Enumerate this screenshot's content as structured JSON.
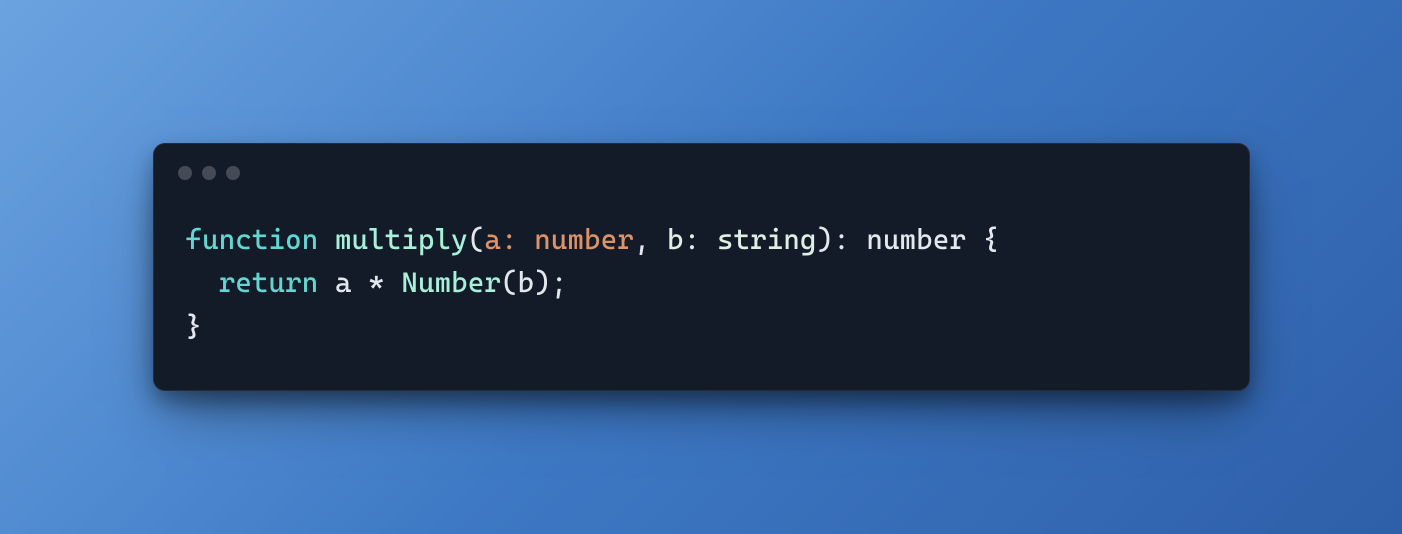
{
  "window": {
    "traffic_lights": [
      "close",
      "minimize",
      "zoom"
    ]
  },
  "code": {
    "language": "typescript",
    "tokens": [
      [
        {
          "t": "function",
          "cls": "tok-keyword"
        },
        {
          "t": " ",
          "cls": "tok-default"
        },
        {
          "t": "multiply",
          "cls": "tok-func"
        },
        {
          "t": "(",
          "cls": "tok-punct"
        },
        {
          "t": "a",
          "cls": "tok-param1"
        },
        {
          "t": ": ",
          "cls": "tok-type1"
        },
        {
          "t": "number",
          "cls": "tok-type1"
        },
        {
          "t": ", ",
          "cls": "tok-punct"
        },
        {
          "t": "b",
          "cls": "tok-param2"
        },
        {
          "t": ": ",
          "cls": "tok-type2"
        },
        {
          "t": "string",
          "cls": "tok-type2"
        },
        {
          "t": ")",
          "cls": "tok-punct"
        },
        {
          "t": ": ",
          "cls": "tok-rettype"
        },
        {
          "t": "number",
          "cls": "tok-rettype"
        },
        {
          "t": " {",
          "cls": "tok-punct"
        }
      ],
      [
        {
          "t": "  ",
          "cls": "tok-default"
        },
        {
          "t": "return",
          "cls": "tok-return"
        },
        {
          "t": " ",
          "cls": "tok-default"
        },
        {
          "t": "a",
          "cls": "tok-var"
        },
        {
          "t": " * ",
          "cls": "tok-op"
        },
        {
          "t": "Number",
          "cls": "tok-class"
        },
        {
          "t": "(",
          "cls": "tok-punct"
        },
        {
          "t": "b",
          "cls": "tok-var"
        },
        {
          "t": ");",
          "cls": "tok-punct"
        }
      ],
      [
        {
          "t": "}",
          "cls": "tok-punct"
        }
      ]
    ]
  }
}
